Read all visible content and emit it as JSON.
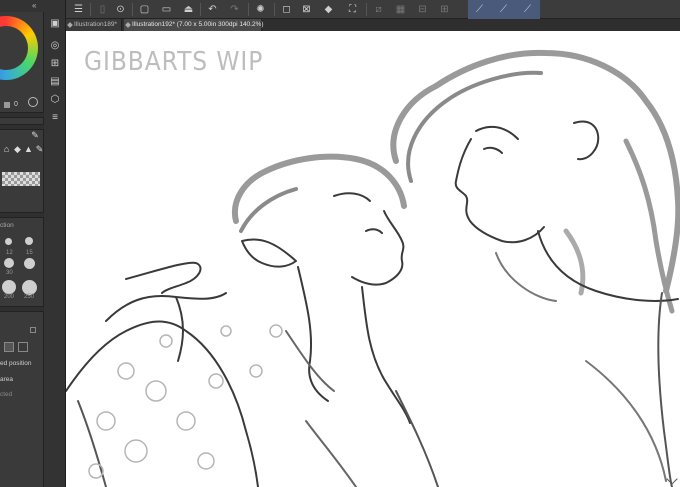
{
  "tabs": [
    {
      "label": "Illustration189*"
    },
    {
      "label": "Illustration192* (7.00 x 5.00in 300dpi 140.2%)"
    }
  ],
  "canvas": {
    "title": "GIBBARTS WIP"
  },
  "color_panel": {
    "value": "0"
  },
  "brush_size": {
    "label": "ction",
    "sizes": [
      "12",
      "15",
      "30",
      "200",
      "250"
    ]
  },
  "tool_options": {
    "labels": [
      "ed position",
      "area",
      "cted"
    ]
  },
  "colors": {
    "canvas_bg": "#ffffff",
    "panel_bg": "#3a3a3a",
    "active_tool": "#4a5a7a",
    "sketch_line": "#3a3a3a"
  },
  "icons": {
    "command_bar": [
      "menu-icon",
      "new-file-icon",
      "open-icon",
      "save-icon",
      "undo-icon",
      "redo-icon",
      "loading-icon",
      "clear-icon",
      "fill-icon",
      "transform-icon",
      "ruler-icon",
      "snap-ruler-icon",
      "snap-line-icon",
      "snap-grid-icon"
    ]
  }
}
